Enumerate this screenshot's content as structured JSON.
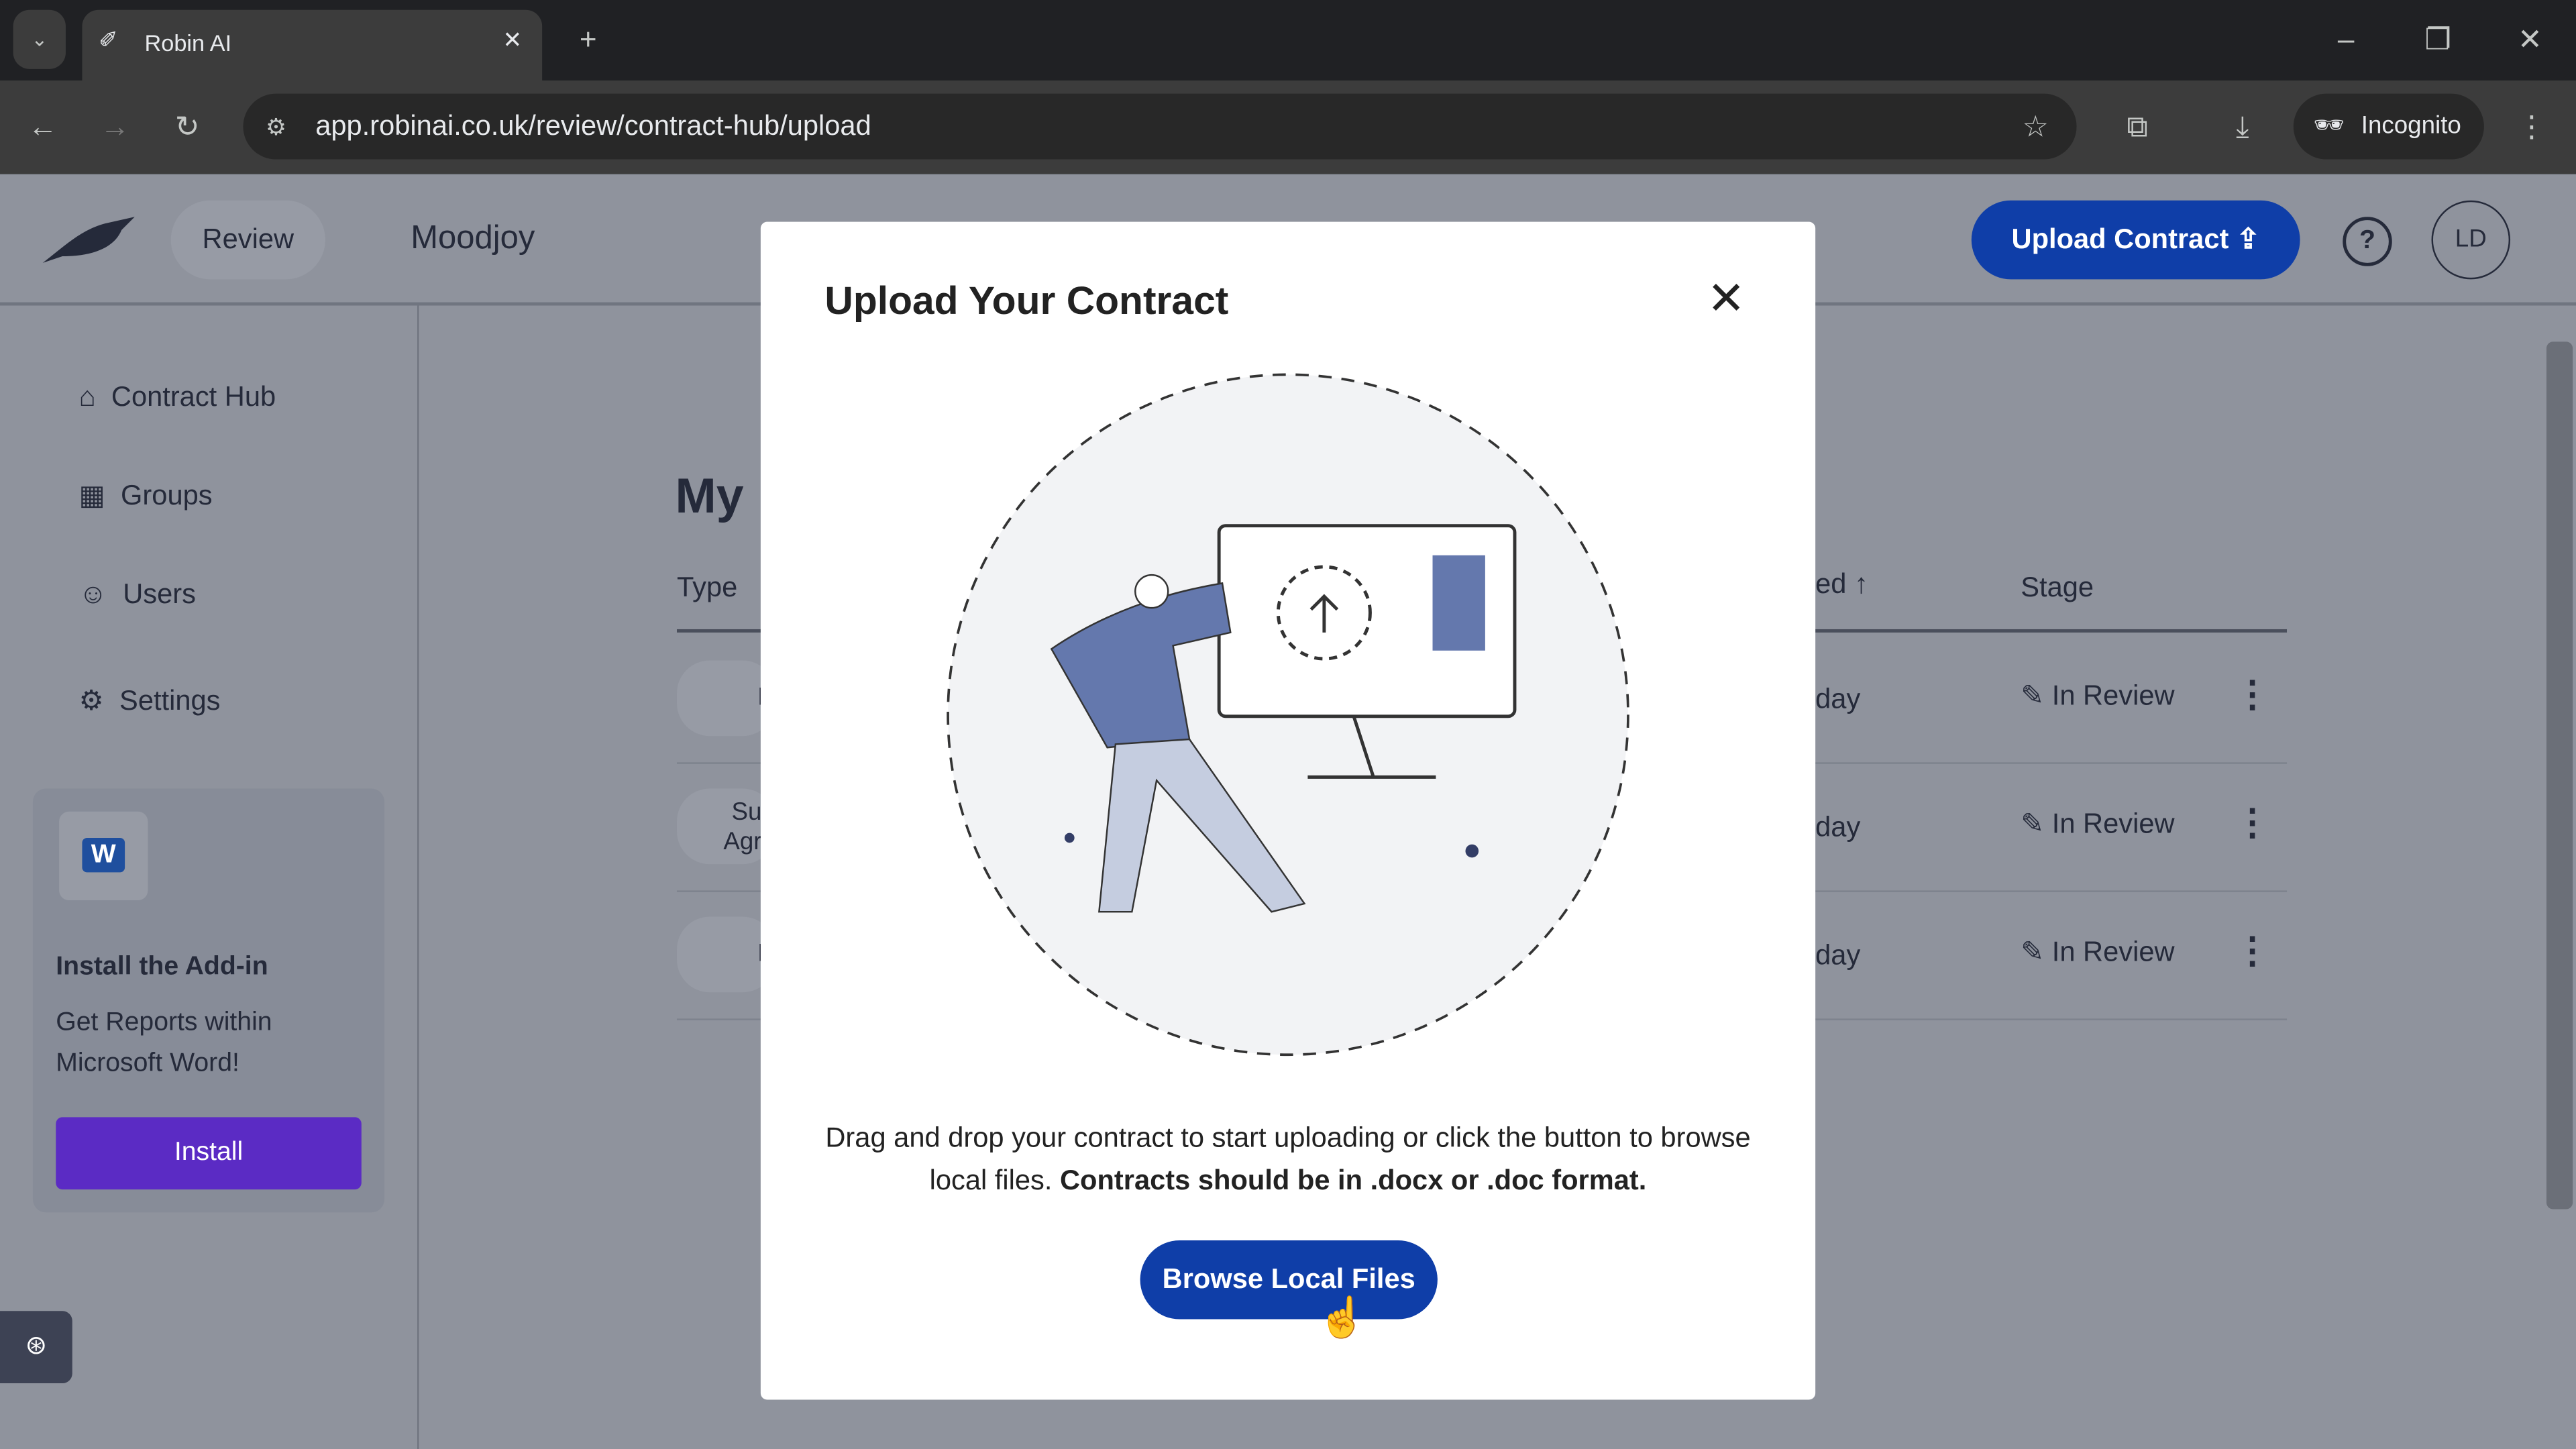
{
  "browser": {
    "tab_title": "Robin AI",
    "url": "app.robinai.co.uk/review/contract-hub/upload",
    "incognito_label": "Incognito"
  },
  "header": {
    "review_label": "Review",
    "org_name": "Moodjoy",
    "upload_button": "Upload Contract",
    "avatar": "LD"
  },
  "sidebar": {
    "items": [
      {
        "label": "Contract Hub",
        "icon": "home-icon"
      },
      {
        "label": "Groups",
        "icon": "grid-icon"
      },
      {
        "label": "Users",
        "icon": "user-icon"
      },
      {
        "label": "Settings",
        "icon": "gear-icon"
      }
    ],
    "addin": {
      "title": "Install the Add-in",
      "text": "Get Reports within Microsoft Word!",
      "button": "Install"
    }
  },
  "main": {
    "title_partial": "My",
    "columns": {
      "type": "Type",
      "date_partial": "ed",
      "stage": "Stage"
    },
    "rows": [
      {
        "type_partial": "N",
        "date_partial": "day",
        "stage": "In Review"
      },
      {
        "type_partial": "Sup Agre",
        "date_partial": "day",
        "stage": "In Review"
      },
      {
        "type_partial": "N",
        "date_partial": "day",
        "stage": "In Review"
      }
    ]
  },
  "modal": {
    "title": "Upload Your Contract",
    "text": "Drag and drop your contract to start uploading or click the button to browse local files.",
    "text_bold": "Contracts should be in .docx or .doc format.",
    "button": "Browse Local Files"
  },
  "colors": {
    "primary": "#0f3ea8",
    "install": "#5b2bc4",
    "illustration": "#6478ad"
  }
}
